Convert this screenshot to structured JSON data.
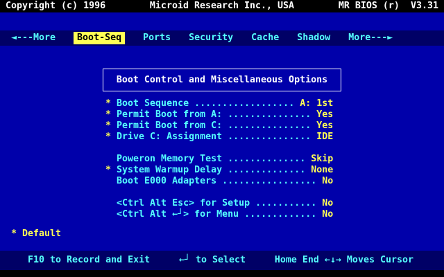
{
  "colors": {
    "background": "#0000AA",
    "bar": "#000066",
    "topbar_bg": "#000000",
    "text_cyan": "#55FFFF",
    "text_yellow": "#FFFF55",
    "text_white": "#FFFFFF",
    "active_tab_bg": "#FFFF55",
    "active_tab_text": "#000000"
  },
  "top_bar": {
    "left": "Copyright (c) 1996",
    "center": "Microid Research Inc., USA",
    "right": "MR BIOS (r)  V3.31"
  },
  "menu": {
    "items": [
      {
        "id": "more-left",
        "label": "◄---More",
        "active": false
      },
      {
        "id": "boot-seq",
        "label": "Boot-Seq",
        "active": true
      },
      {
        "id": "ports",
        "label": "Ports",
        "active": false
      },
      {
        "id": "security",
        "label": "Security",
        "active": false
      },
      {
        "id": "cache",
        "label": "Cache",
        "active": false
      },
      {
        "id": "shadow",
        "label": "Shadow",
        "active": false
      },
      {
        "id": "more-right",
        "label": "More---►",
        "active": false
      }
    ]
  },
  "dialog": {
    "title": "Boot Control and Miscellaneous Options"
  },
  "options": [
    {
      "id": "boot-sequence",
      "star": "* ",
      "label": "Boot Sequence",
      "dots": " .................. ",
      "value": "A: 1st"
    },
    {
      "id": "permit-boot-a",
      "star": "* ",
      "label": "Permit Boot from A:",
      "dots": " ............... ",
      "value": "Yes"
    },
    {
      "id": "permit-boot-c",
      "star": "* ",
      "label": "Permit Boot from C:",
      "dots": " ............... ",
      "value": "Yes"
    },
    {
      "id": "drive-c-assignment",
      "star": "* ",
      "label": "Drive C: Assignment",
      "dots": " ............... ",
      "value": "IDE"
    },
    {
      "spacer": true
    },
    {
      "id": "poweron-memory-test",
      "star": "  ",
      "label": "Poweron Memory Test",
      "dots": " .............. ",
      "value": "Skip"
    },
    {
      "id": "system-warmup-delay",
      "star": "* ",
      "label": "System Warmup Delay",
      "dots": " .............. ",
      "value": "None"
    },
    {
      "id": "boot-e000-adapters",
      "star": "  ",
      "label": "Boot E000 Adapters",
      "dots": " ................. ",
      "value": "No"
    },
    {
      "spacer": true
    },
    {
      "id": "ctrl-alt-esc-setup",
      "star": "  ",
      "label": "<Ctrl Alt Esc> for Setup",
      "dots": " ........... ",
      "value": "No"
    },
    {
      "id": "ctrl-alt-enter-menu",
      "star": "  ",
      "label": "<Ctrl Alt ←┘> for Menu",
      "dots": " ............. ",
      "value": "No"
    }
  ],
  "legend": {
    "star": "* ",
    "text": "Default"
  },
  "status_bar": {
    "record": "F10 to Record and Exit",
    "select": "←┘ to Select",
    "cursor": "Home End ←↓→ Moves Cursor"
  }
}
